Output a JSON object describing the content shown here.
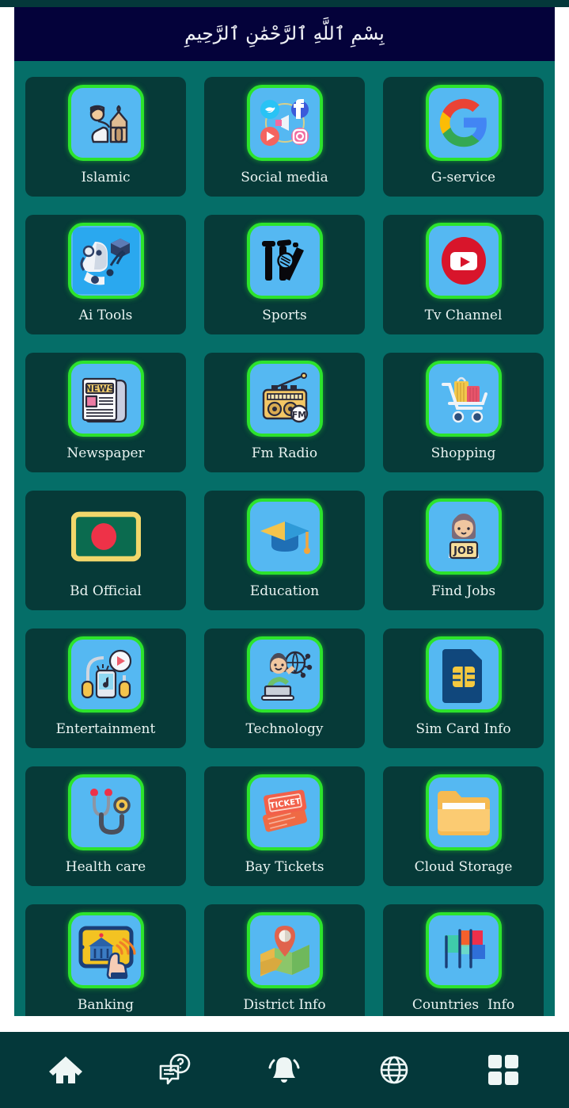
{
  "header": {
    "bismillah": "بِسْمِ ٱللَّهِ ٱلرَّحْمَٰنِ ٱلرَّحِيمِ",
    "background_color": "#04023a",
    "text_color": "#f2f4f8"
  },
  "theme": {
    "page_background": "#056e68",
    "tile_background": "#063a38",
    "icon_background": "#55b8f2",
    "icon_border": "#2ce32c",
    "label_color": "#eaf4f2",
    "nav_background": "#04383a",
    "nav_icon_color": "#eef6f5"
  },
  "grid": {
    "columns": 3,
    "tiles": [
      {
        "label": "Islamic",
        "icon": "mosque-prayer-icon"
      },
      {
        "label": "Social media",
        "icon": "social-media-icon"
      },
      {
        "label": "G-service",
        "icon": "google-g-icon"
      },
      {
        "label": "Ai Tools",
        "icon": "robot-ai-icon"
      },
      {
        "label": "Sports",
        "icon": "cricket-icon"
      },
      {
        "label": "Tv Channel",
        "icon": "youtube-icon"
      },
      {
        "label": "Newspaper",
        "icon": "newspaper-icon"
      },
      {
        "label": "Fm Radio",
        "icon": "radio-fm-icon"
      },
      {
        "label": "Shopping",
        "icon": "shopping-cart-icon"
      },
      {
        "label": "Bd Official",
        "icon": "bangladesh-flag-icon"
      },
      {
        "label": "Education",
        "icon": "graduation-cap-icon"
      },
      {
        "label": "Find Jobs",
        "icon": "job-seeker-icon"
      },
      {
        "label": "Entertainment",
        "icon": "headphones-music-icon"
      },
      {
        "label": "Technology",
        "icon": "technology-person-icon"
      },
      {
        "label": "Sim Card Info",
        "icon": "sim-card-icon"
      },
      {
        "label": "Health care",
        "icon": "stethoscope-icon"
      },
      {
        "label": "Bay Tickets",
        "icon": "ticket-icon"
      },
      {
        "label": "Cloud Storage",
        "icon": "folder-icon"
      },
      {
        "label": "Banking",
        "icon": "mobile-banking-icon"
      },
      {
        "label": "District Info",
        "icon": "map-pin-icon"
      },
      {
        "label": "Countries  Info",
        "icon": "flags-icon"
      }
    ]
  },
  "bottom_nav": {
    "items": [
      {
        "name": "home",
        "icon": "home-icon"
      },
      {
        "name": "faq",
        "icon": "chat-question-icon"
      },
      {
        "name": "notifications",
        "icon": "bell-icon"
      },
      {
        "name": "website",
        "icon": "globe-icon"
      },
      {
        "name": "apps",
        "icon": "grid-apps-icon"
      }
    ]
  }
}
